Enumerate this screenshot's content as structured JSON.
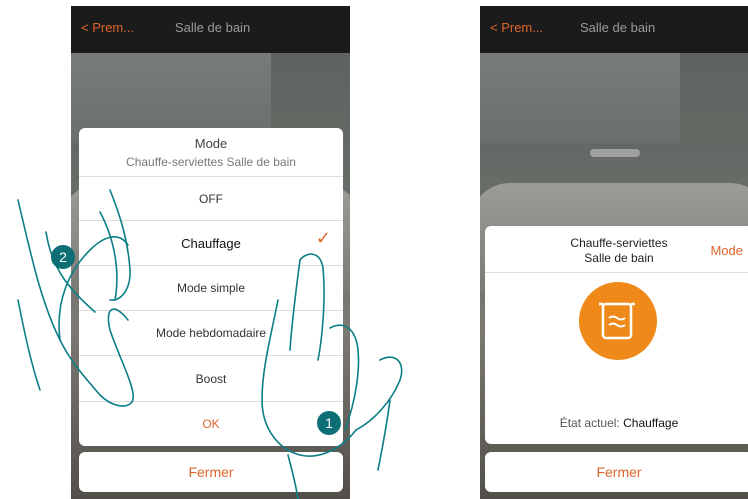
{
  "left_screen": {
    "back_label": "< Prem...",
    "title": "Salle de bain",
    "dialog": {
      "heading": "Mode",
      "subheading": "Chauffe-serviettes Salle de bain",
      "options": [
        "OFF",
        "Chauffage",
        "Mode simple",
        "Mode hebdomadaire",
        "Boost"
      ],
      "selected_option": "Chauffage",
      "ok_label": "OK"
    },
    "close_label": "Fermer"
  },
  "right_screen": {
    "back_label": "< Prem...",
    "title": "Salle de bain",
    "card": {
      "device_name_line1": "Chauffe-serviettes",
      "device_name_line2": "Salle de bain",
      "mode_link": "Mode",
      "device_icon": "towel-rail-icon",
      "status_label": "État actuel:",
      "status_value": "Chauffage"
    },
    "close_label": "Fermer"
  },
  "callouts": [
    "1",
    "2"
  ],
  "colors": {
    "accent": "#e0632a",
    "badge": "#0d6f75",
    "topbar": "#1b1b1b"
  }
}
